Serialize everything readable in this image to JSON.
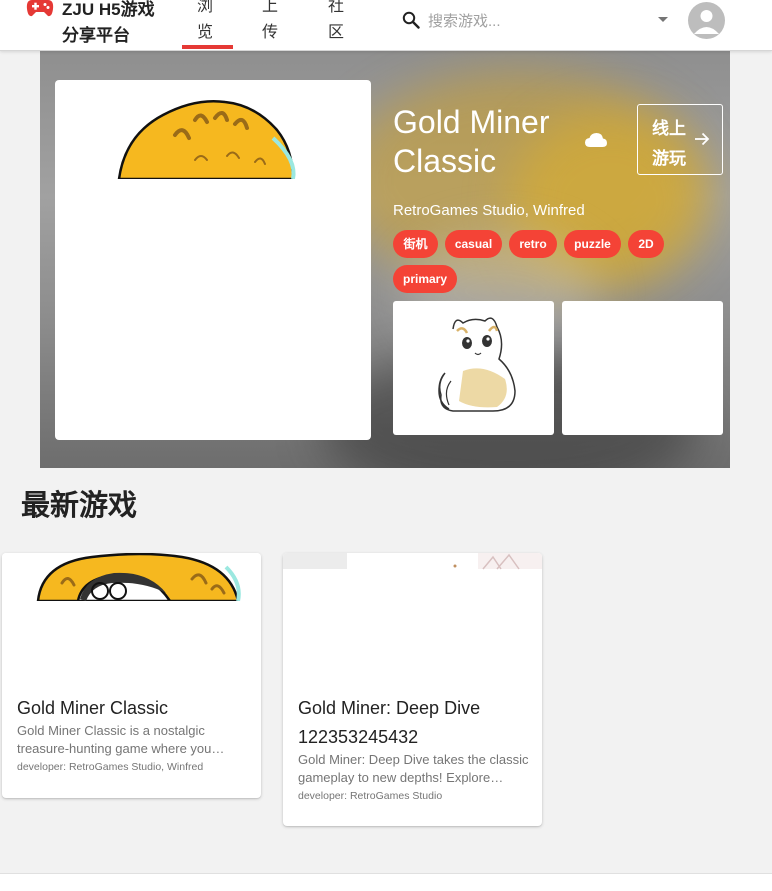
{
  "header": {
    "brand": "ZJU H5游戏 分享平台",
    "tabs": [
      {
        "label": "浏览",
        "active": true
      },
      {
        "label": "上传",
        "active": false
      },
      {
        "label": "社区",
        "active": false
      }
    ],
    "search": {
      "placeholder": "搜索游戏...",
      "value": ""
    },
    "icons": {
      "logo": "gamepad-icon",
      "search": "search-icon",
      "dropdown": "chevron-down-icon",
      "avatar": "account-circle-icon"
    },
    "accent_color": "#e53935"
  },
  "featured": {
    "title": "Gold Miner Classic",
    "developer": "RetroGames Studio, Winfred",
    "play_button": "线上游玩",
    "tags": [
      "街机",
      "casual",
      "retro",
      "puzzle",
      "2D",
      "primary"
    ],
    "icons": {
      "cloud": "cloud-icon",
      "arrow": "arrow-right-icon"
    },
    "tag_color": "#f44336"
  },
  "latest": {
    "title": "最新游戏",
    "games": [
      {
        "title": "Gold Miner Classic",
        "description": "Gold Miner Classic is a nostalgic treasure-hunting game where you…",
        "developer": "developer: RetroGames Studio, Winfred"
      },
      {
        "title": "Gold Miner: Deep Dive 122353245432",
        "description": "Gold Miner: Deep Dive takes the classic gameplay to new depths! Explore…",
        "developer": "developer: RetroGames Studio"
      }
    ]
  }
}
